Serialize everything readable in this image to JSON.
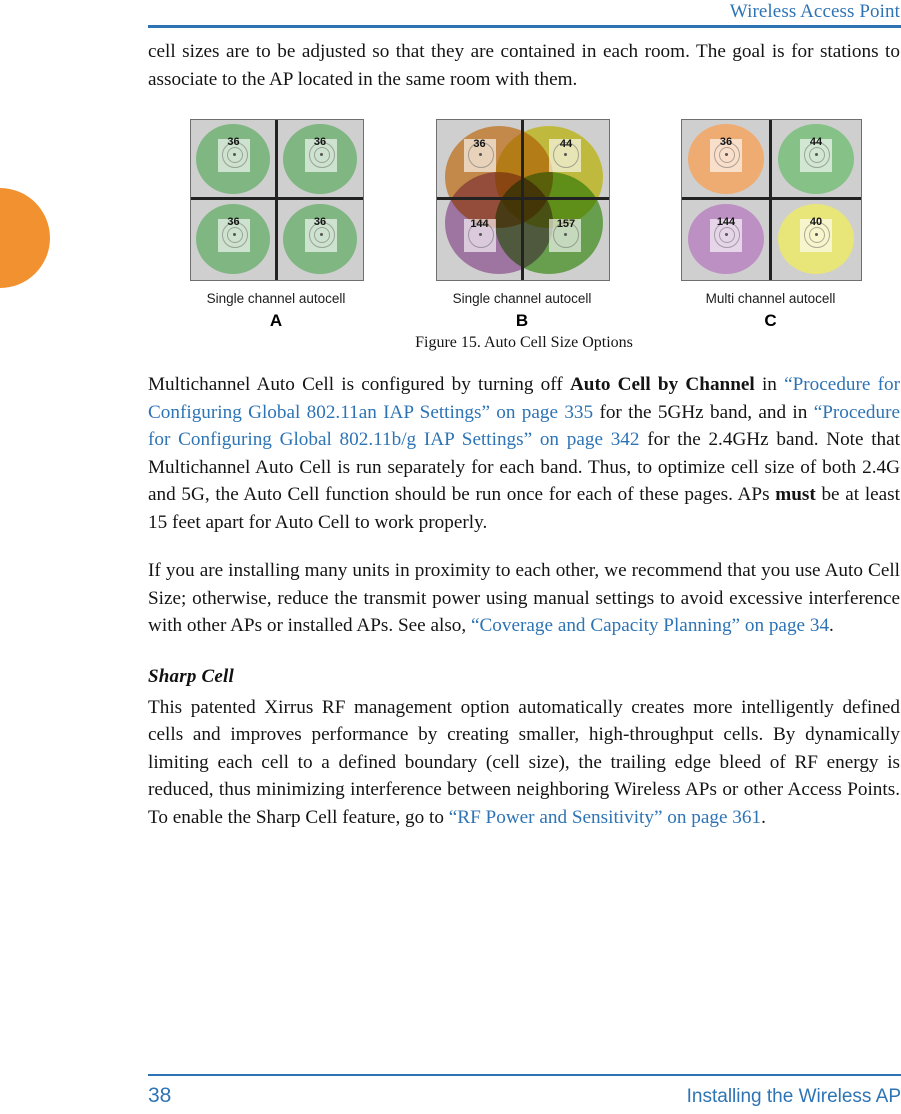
{
  "header": {
    "title": "Wireless Access Point",
    "accent_color": "#2e74b5"
  },
  "paragraphs": {
    "intro": "cell sizes are to be adjusted so that they are contained in each room. The goal is for stations to associate to the AP located in the same room with them.",
    "multichannel": {
      "seg1": "Multichannel Auto Cell is configured by turning off ",
      "bold1": "Auto Cell by Channel",
      "seg2": " in ",
      "link1": "“Procedure for Configuring Global 802.11an IAP Settings” on page 335",
      "seg3": " for the 5GHz band, and in ",
      "link2": "“Procedure for Configuring Global 802.11b/g IAP Settings” on page 342",
      "seg4": " for the 2.4GHz band. Note that Multichannel Auto Cell is run separately for each band. Thus, to  optimize cell size of both 2.4G and 5G, the Auto Cell function should be run once for each of these pages. APs ",
      "bold2": "must",
      "seg5": " be at least 15 feet apart for Auto Cell to work properly."
    },
    "proximity": {
      "seg1": "If you are installing many units in proximity to each other, we recommend that you use Auto Cell Size; otherwise, reduce the transmit power using manual settings to avoid excessive interference with other APs or installed APs. See also, ",
      "link1": "“Coverage and Capacity Planning” on page 34",
      "seg2": "."
    },
    "sharp_cell_heading": "Sharp Cell",
    "sharp_cell": {
      "seg1": "This patented Xirrus RF management option automatically creates more intelligently defined cells and improves performance by creating smaller, high-throughput cells. By dynamically limiting each cell to a defined boundary (cell size), the trailing edge bleed of RF energy is reduced, thus minimizing interference between neighboring Wireless APs or other Access Points. To enable the Sharp Cell feature, go to ",
      "link1": "“RF Power and Sensitivity” on page 361",
      "seg2": "."
    }
  },
  "figure": {
    "caption": "Figure 15. Auto Cell Size Options",
    "panels": [
      {
        "id": "A",
        "letter": "A",
        "caption": "Single channel autocell",
        "style": "separate-rooms",
        "cells": [
          {
            "channel": "36",
            "color": "#7fb682"
          },
          {
            "channel": "36",
            "color": "#7fb682"
          },
          {
            "channel": "36",
            "color": "#7fb682"
          },
          {
            "channel": "36",
            "color": "#7fb682"
          }
        ]
      },
      {
        "id": "B",
        "letter": "B",
        "caption": "Single channel autocell",
        "style": "overlapping",
        "cells": [
          {
            "channel": "36",
            "color": "#f0a95c"
          },
          {
            "channel": "44",
            "color": "#ece64b"
          },
          {
            "channel": "144",
            "color": "#c38fc6"
          },
          {
            "channel": "157",
            "color": "#7fc461"
          }
        ]
      },
      {
        "id": "C",
        "letter": "C",
        "caption": "Multi channel autocell",
        "style": "separate-rooms",
        "cells": [
          {
            "channel": "36",
            "color": "#eeac72"
          },
          {
            "channel": "44",
            "color": "#86c187"
          },
          {
            "channel": "144",
            "color": "#bd90c4"
          },
          {
            "channel": "40",
            "color": "#e8e579"
          }
        ]
      }
    ]
  },
  "footer": {
    "page_number": "38",
    "section": "Installing the Wireless AP"
  },
  "thumb_tab_color": "#f2912f"
}
